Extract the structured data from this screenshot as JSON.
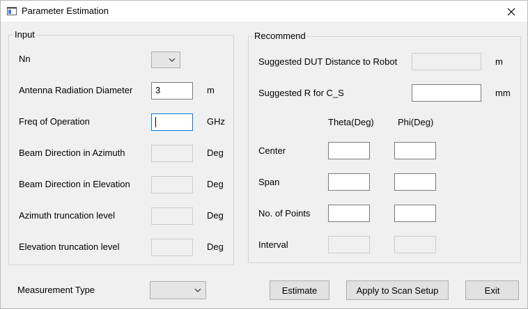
{
  "window": {
    "title": "Parameter Estimation"
  },
  "input_group": {
    "title": "Input",
    "nn_label": "Nn",
    "antenna_diameter": {
      "label": "Antenna Radiation Diameter",
      "value": "3",
      "unit": "m"
    },
    "freq": {
      "label": "Freq of Operation",
      "value": "",
      "unit": "GHz"
    },
    "beam_azimuth": {
      "label": "Beam Direction in Azimuth",
      "value": "",
      "unit": "Deg"
    },
    "beam_elevation": {
      "label": "Beam Direction in Elevation",
      "value": "",
      "unit": "Deg"
    },
    "azimuth_truncation": {
      "label": "Azimuth truncation level",
      "value": "",
      "unit": "Deg"
    },
    "elevation_truncation": {
      "label": "Elevation truncation level",
      "value": "",
      "unit": "Deg"
    }
  },
  "recommend_group": {
    "title": "Recommend",
    "dut_distance": {
      "label": "Suggested DUT Distance to Robot",
      "value": "",
      "unit": "m"
    },
    "r_for_cs": {
      "label": "Suggested R for C_S",
      "value": "",
      "unit": "mm"
    },
    "columns": [
      "Theta(Deg)",
      "Phi(Deg)"
    ],
    "rows": [
      {
        "label": "Center",
        "theta": "",
        "phi": ""
      },
      {
        "label": "Span",
        "theta": "",
        "phi": ""
      },
      {
        "label": "No. of Points",
        "theta": "",
        "phi": ""
      },
      {
        "label": "Interval",
        "theta": "",
        "phi": ""
      }
    ]
  },
  "footer": {
    "measurement_type_label": "Measurement Type",
    "estimate_label": "Estimate",
    "apply_label": "Apply to Scan Setup",
    "exit_label": "Exit"
  },
  "icons": {
    "app": "window-icon",
    "close": "close-icon",
    "dropdown": "chevron-down-icon"
  }
}
